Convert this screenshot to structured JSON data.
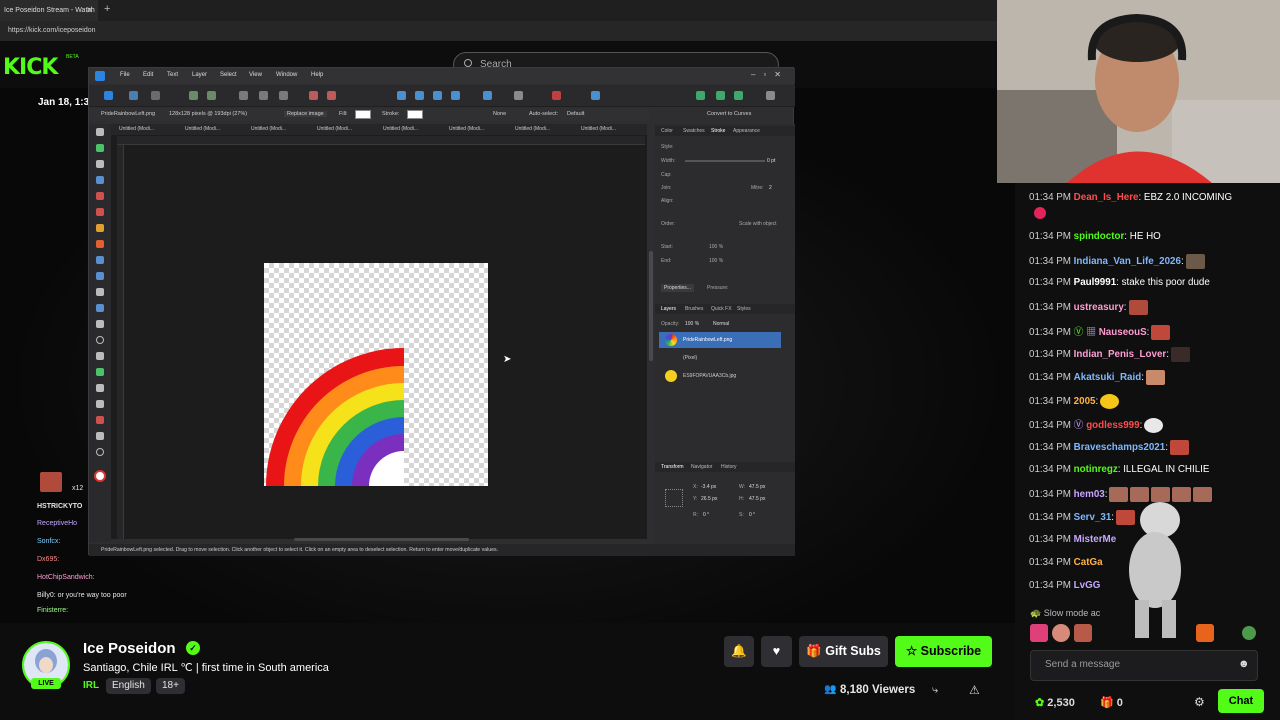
{
  "browser": {
    "tab_title": "Ice Poseidon Stream - Watch",
    "url": "https://kick.com/iceposeidon"
  },
  "site": {
    "logo": "KICK",
    "logo_badge": "BETA",
    "search_placeholder": "Search"
  },
  "video": {
    "date_overlay": "Jan 18, 1:3"
  },
  "app": {
    "menus": [
      "File",
      "Edit",
      "Text",
      "Layer",
      "Select",
      "View",
      "Window",
      "Help"
    ],
    "context": {
      "file_name": "PrideRainbowLeft.png",
      "image_info": "128x128 pixels @ 193dpi (27%)",
      "replace_image": "Replace image",
      "fill_label": "Fill:",
      "stroke_label": "Stroke:",
      "stroke_none": "None",
      "auto_select": "Auto-select:",
      "auto_select_value": "Default",
      "convert_curves": "Convert to Curves"
    },
    "doc_tabs": [
      "Untitled (Modi...",
      "Untitled (Modi...",
      "Untitled (Modi...",
      "Untitled (Modi...",
      "Untitled (Modi...",
      "Untitled (Modi...",
      "Untitled (Modi...",
      "Untitled (Modi..."
    ],
    "status_bar": "PrideRainbowLeft.png selected. Drag to move selection. Click another object to select it. Click on an empty area to deselect selection. Return to enter move/duplicate values.",
    "panels": {
      "top_tabs": [
        "Color",
        "Swatches",
        "Stroke",
        "Appearance"
      ],
      "style_label": "Style:",
      "width_label": "Width:",
      "width_value": "0 pt",
      "cap_label": "Cap:",
      "join_label": "Join:",
      "mitre_label": "Mitre:",
      "mitre_value": "2",
      "align_label": "Align:",
      "order_label": "Order:",
      "scale_label": "Scale with object",
      "start_label": "Start:",
      "end_label": "End:",
      "pct_100": "100 %",
      "properties_btn": "Properties...",
      "pressure_label": "Pressure:",
      "layer_tabs": [
        "Layers",
        "Brushes",
        "Quick FX",
        "Styles"
      ],
      "opacity_label": "Opacity:",
      "opacity_value": "100 %",
      "blend_mode": "Normal",
      "layers": [
        "PrideRainbowLeft.png",
        "(Pixel)",
        "ES9FOPAVUAA3Cb.jpg"
      ],
      "transform_tabs": [
        "Transform",
        "Navigator",
        "History"
      ],
      "x_label": "X:",
      "x_value": "-3.4 px",
      "y_label": "Y:",
      "y_value": "26.5 px",
      "w_label": "W:",
      "w_value": "47.5 px",
      "h_label": "H:",
      "h_value": "47.5 px",
      "r_label": "R:",
      "r_value": "0 °",
      "s_label": "S:",
      "s_value": "0 °"
    }
  },
  "overlay_chat": [
    {
      "text": "x12",
      "color": "#ffffff"
    },
    {
      "text": "HSTRICKYTO",
      "color": "#ffffff"
    },
    {
      "text": "ReceptiveHo",
      "color": "#c7a6ff"
    },
    {
      "text": "Sonfcx:",
      "color": "#7fd0ff"
    },
    {
      "text": "Dx695:",
      "color": "#ff8a8a"
    },
    {
      "text": "HotChipSandwich:",
      "color": "#ff9ed1"
    },
    {
      "text": "Billy0: or you're way too poor",
      "color": "#ffffff"
    },
    {
      "text": "Finisterre:",
      "color": "#9dff8a"
    }
  ],
  "stream": {
    "streamer": "Ice Poseidon",
    "title": "Santiago, Chile IRL ℃ | first time in South america",
    "category": "IRL",
    "tags": [
      "English",
      "18+"
    ],
    "live_badge": "LIVE",
    "gift_subs": "Gift Subs",
    "subscribe": "Subscribe",
    "viewers": "8,180 Viewers"
  },
  "chat": {
    "messages": [
      {
        "time": "01:34 PM",
        "user": "Dean_Is_Here",
        "color": "#ff4d4d",
        "text": ": EBZ 2.0 INCOMING",
        "emotes": 1
      },
      {
        "time": "01:34 PM",
        "user": "spindoctor",
        "color": "#53fc18",
        "text": ": HE HO",
        "emotes": 0
      },
      {
        "time": "01:34 PM",
        "user": "Indiana_Van_Life_2026",
        "color": "#7fb8ff",
        "text": ":",
        "emotes": 1
      },
      {
        "time": "01:34 PM",
        "user": "Paul9991",
        "color": "#ffffff",
        "text": ": stake this poor dude",
        "emotes": 0
      },
      {
        "time": "01:34 PM",
        "user": "ustreasury",
        "color": "#ff9ed1",
        "text": ":",
        "emotes": 1
      },
      {
        "time": "01:34 PM",
        "user": "NauseouS",
        "color": "#ff9ed1",
        "text": ":",
        "emotes": 1
      },
      {
        "time": "01:34 PM",
        "user": "Indian_Penis_Lover",
        "color": "#ff9ed1",
        "text": ":",
        "emotes": 1
      },
      {
        "time": "01:34 PM",
        "user": "Akatsuki_Raid",
        "color": "#7fb8ff",
        "text": ":",
        "emotes": 1
      },
      {
        "time": "01:34 PM",
        "user": "2005",
        "color": "#ffb347",
        "text": ":",
        "emotes": 1
      },
      {
        "time": "01:34 PM",
        "user": "godless999",
        "color": "#ff4d4d",
        "text": ":",
        "emotes": 1
      },
      {
        "time": "01:34 PM",
        "user": "Braveschamps2021",
        "color": "#7fb8ff",
        "text": ":",
        "emotes": 1
      },
      {
        "time": "01:34 PM",
        "user": "notinregz",
        "color": "#53fc18",
        "text": ": ILLEGAL IN CHILIE",
        "emotes": 0
      },
      {
        "time": "01:34 PM",
        "user": "hem03",
        "color": "#c7a6ff",
        "text": ":",
        "emotes": 5
      },
      {
        "time": "01:34 PM",
        "user": "Serv_31",
        "color": "#7fb8ff",
        "text": ":",
        "emotes": 1
      },
      {
        "time": "01:34 PM",
        "user": "MisterMe",
        "color": "#c7a6ff",
        "text": "",
        "emotes": 0
      },
      {
        "time": "01:34 PM",
        "user": "CatGa",
        "color": "#ffb347",
        "text": "",
        "emotes": 0
      },
      {
        "time": "01:34 PM",
        "user": "LvGG",
        "color": "#c7a6ff",
        "text": "",
        "emotes": 0
      }
    ],
    "slow_mode": "Slow mode ac",
    "input_placeholder": "Send a message",
    "points": "2,530",
    "gift_count": "0",
    "chat_button": "Chat"
  }
}
